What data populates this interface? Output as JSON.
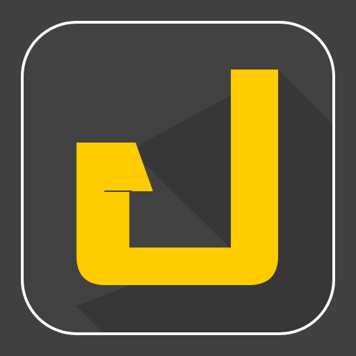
{
  "app_icon": {
    "icon": "letter-j-logo-icon",
    "colors": {
      "background": "#414141",
      "tile_fill": "#424242",
      "tile_border": "#ffffff",
      "long_shadow": "#373737",
      "glyph": "#ffcc00"
    }
  }
}
